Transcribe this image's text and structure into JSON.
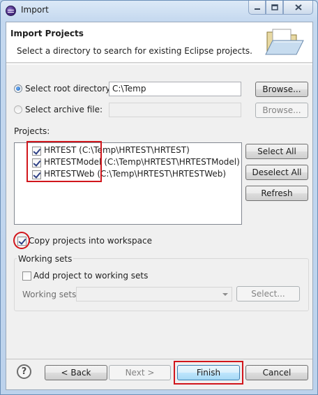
{
  "window": {
    "title": "Import"
  },
  "banner": {
    "title": "Import Projects",
    "description": "Select a directory to search for existing Eclipse projects.",
    "icon": "folder-open-icon"
  },
  "source": {
    "root_dir_label": "Select root directory:",
    "root_dir_value": "C:\\Temp",
    "root_dir_selected": true,
    "browse_label": "Browse...",
    "archive_label": "Select archive file:",
    "archive_value": "",
    "archive_browse_label": "Browse..."
  },
  "projects": {
    "label": "Projects:",
    "items": [
      {
        "label": "HRTEST (C:\\Temp\\HRTEST\\HRTEST)",
        "checked": true
      },
      {
        "label": "HRTESTModel (C:\\Temp\\HRTEST\\HRTESTModel)",
        "checked": true
      },
      {
        "label": "HRTESTWeb (C:\\Temp\\HRTEST\\HRTESTWeb)",
        "checked": true
      }
    ],
    "select_all_label": "Select All",
    "deselect_all_label": "Deselect All",
    "refresh_label": "Refresh"
  },
  "options": {
    "copy_label": "Copy projects into workspace",
    "copy_checked": true
  },
  "working_sets": {
    "group_label": "Working sets",
    "add_label": "Add project to working sets",
    "add_checked": false,
    "field_label": "Working sets:",
    "select_label": "Select..."
  },
  "footer": {
    "help_glyph": "?",
    "back_label": "< Back",
    "next_label": "Next >",
    "finish_label": "Finish",
    "cancel_label": "Cancel"
  },
  "colors": {
    "annotation_red": "#d1161c",
    "window_frame": "#bcd3ec",
    "primary_button": "#3c7fb1"
  }
}
